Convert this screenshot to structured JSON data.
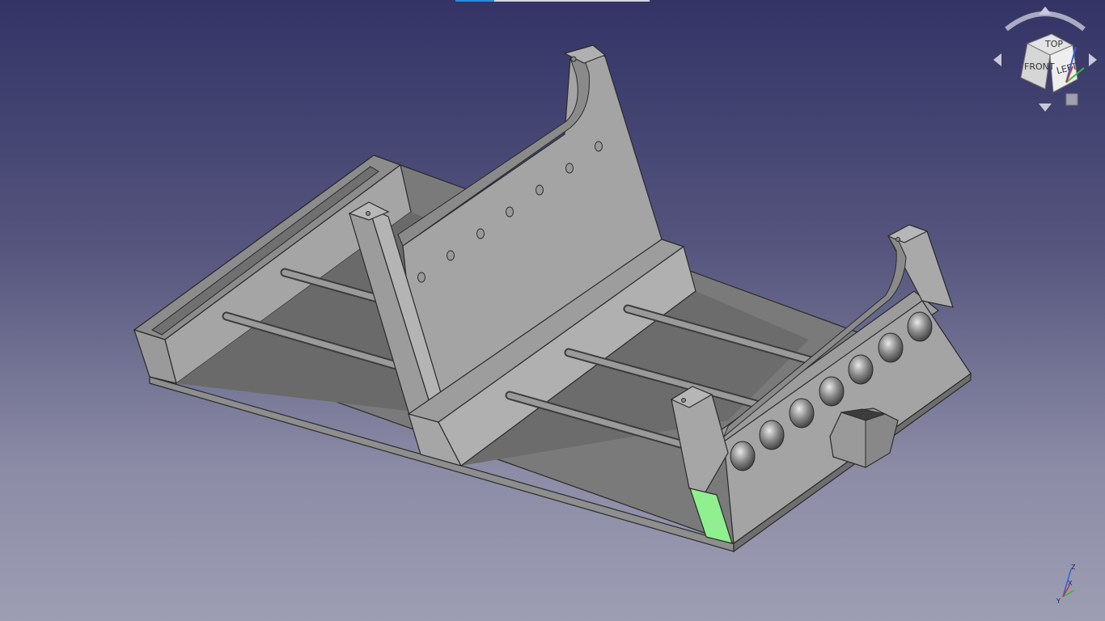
{
  "window": {
    "progress_fraction": 0.2
  },
  "viewport": {
    "background_top": "#333366",
    "background_bottom": "#9d9db3",
    "selected_face_color": "#90f090"
  },
  "navigation_cube": {
    "front_label": "LEFT",
    "top_label": "TOP",
    "side_label": "FRONT"
  },
  "axis_indicator": {
    "x_label": "X",
    "y_label": "Y",
    "z_label": "Z"
  }
}
